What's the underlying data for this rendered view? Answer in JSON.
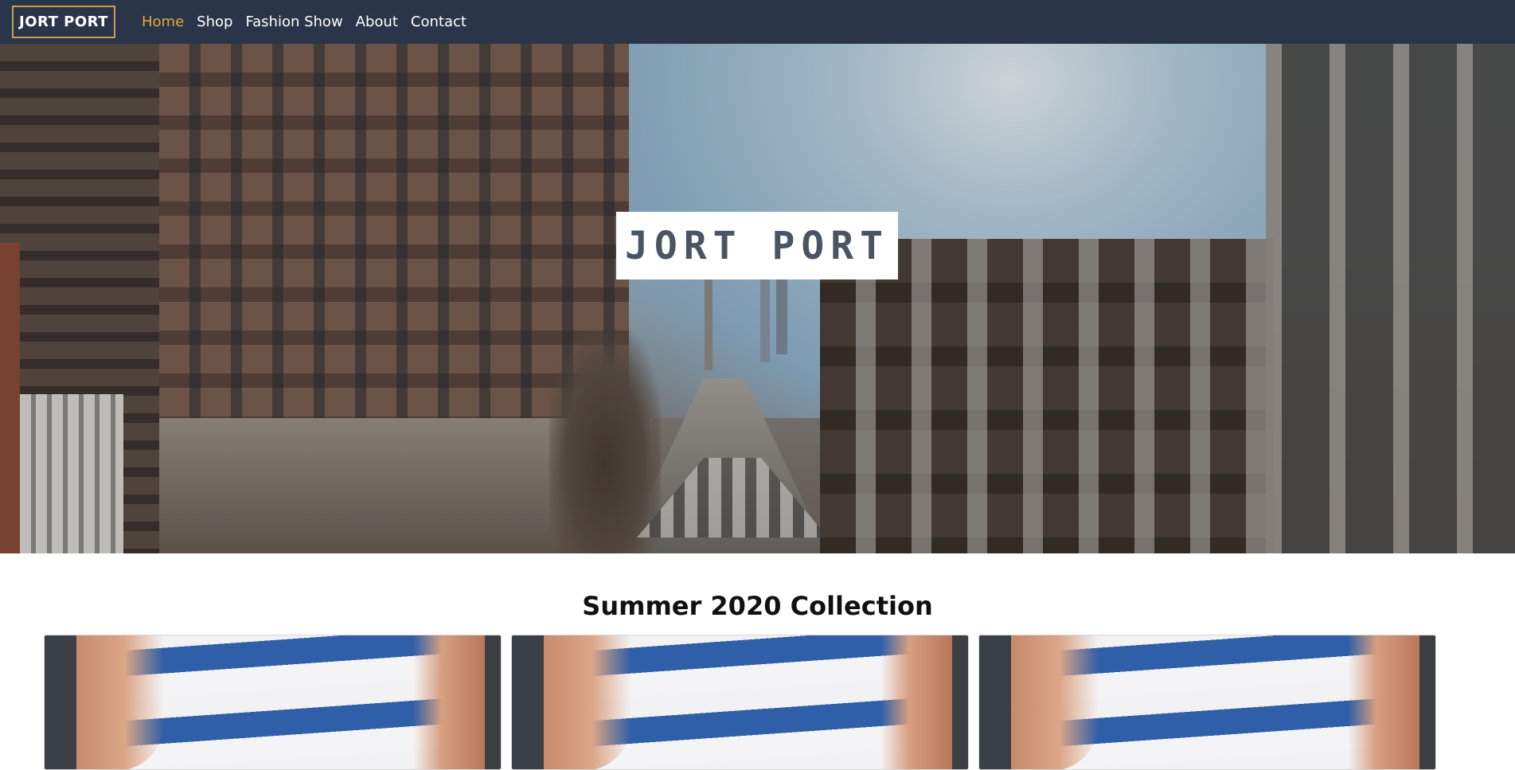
{
  "navbar": {
    "brand": "JORT PORT",
    "links": [
      {
        "label": "Home",
        "active": true
      },
      {
        "label": "Shop",
        "active": false
      },
      {
        "label": "Fashion Show",
        "active": false
      },
      {
        "label": "About",
        "active": false
      },
      {
        "label": "Contact",
        "active": false
      }
    ],
    "background_color": "#2b3549",
    "active_color": "#e2a93b"
  },
  "hero": {
    "logo_text": "JORT PORT",
    "image_description": "city street between tall buildings"
  },
  "collection": {
    "title": "Summer 2020 Collection",
    "cards": [
      {
        "image": "striped-shirt-photo"
      },
      {
        "image": "striped-shirt-photo"
      },
      {
        "image": "striped-shirt-photo"
      }
    ]
  }
}
